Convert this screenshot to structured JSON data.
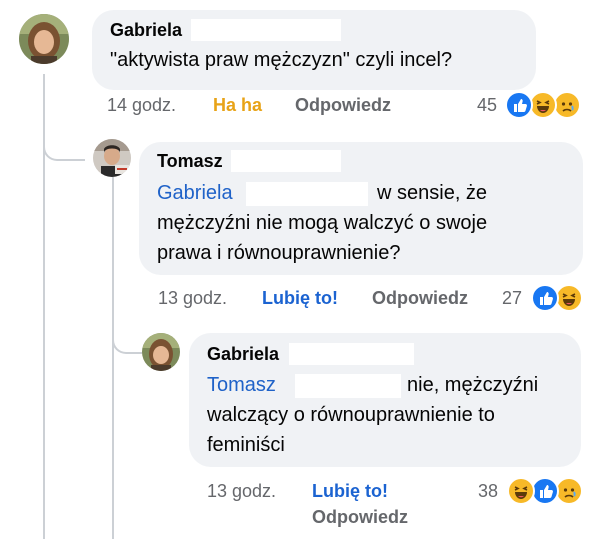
{
  "comments": [
    {
      "author": "Gabriela",
      "text": "\"aktywista praw mężczyzn\" czyli incel?",
      "time": "14 godz.",
      "reaction_label": "Ha ha",
      "reply_label": "Odpowiedz",
      "count": "45",
      "reactions": [
        "like-icon",
        "haha-icon",
        "sad-icon"
      ]
    },
    {
      "author": "Tomasz",
      "mention": "Gabriela",
      "text_line1": "w sensie, że",
      "text_line2": "mężczyźni nie mogą walczyć o swoje",
      "text_line3": "prawa i równouprawnienie?",
      "time": "13 godz.",
      "reaction_label": "Lubię to!",
      "reply_label": "Odpowiedz",
      "count": "27",
      "reactions": [
        "like-icon",
        "haha-icon"
      ]
    },
    {
      "author": "Gabriela",
      "mention": "Tomasz",
      "text_line1": "nie, mężczyźni",
      "text_line2": "walczący o równouprawnienie to",
      "text_line3": "feminiści",
      "time": "13 godz.",
      "reaction_label": "Lubię to!",
      "reply_label": "Odpowiedz",
      "count": "38",
      "reactions": [
        "haha-icon",
        "like-icon",
        "sad-icon"
      ]
    }
  ],
  "colors": {
    "like": "#1877f2",
    "haha_face": "#f7b928",
    "haha_label": "#e8a317",
    "liked_label": "#1b63d1",
    "mention": "#1f62c8"
  }
}
